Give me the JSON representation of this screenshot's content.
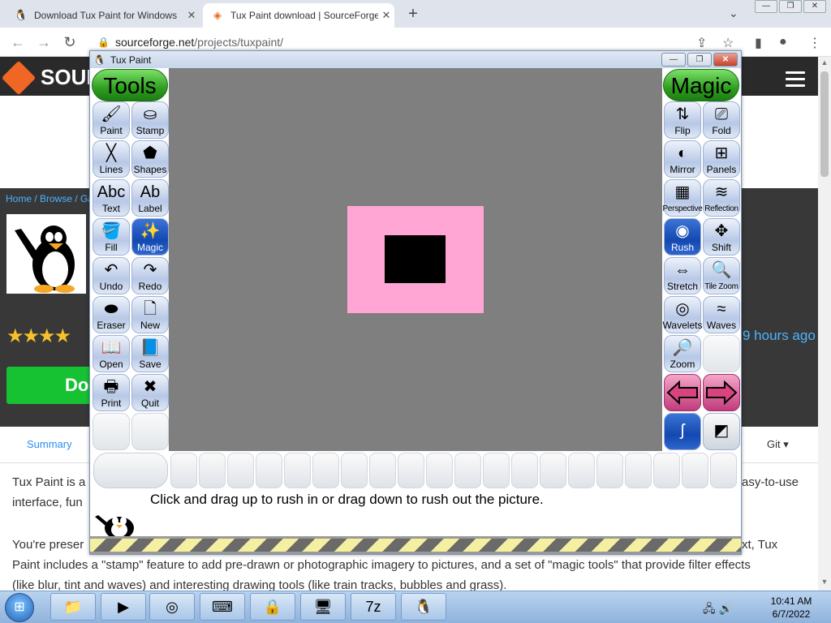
{
  "browser": {
    "tabs": [
      {
        "title": "Download Tux Paint for Windows",
        "favicon": "tux-favicon"
      },
      {
        "title": "Tux Paint download | SourceForge",
        "favicon": "sourceforge-favicon"
      }
    ],
    "new_tab_symbol": "+",
    "url_host": "sourceforge.net",
    "url_path": "/projects/tuxpaint/",
    "window_controls": [
      "—",
      "❐",
      "✕"
    ]
  },
  "page": {
    "logo_text": "SOUR",
    "breadcrumb": "Home / Browse / Ga",
    "stars": "★★★★",
    "download_label": "Do",
    "updated": "9 hours ago",
    "summary_tab": "Summary",
    "git_tab": "Git ▾",
    "line1_left": "Tux Paint is a",
    "line1_right": "asy-to-use",
    "line2": "interface, fun",
    "line3_left": "You're preser",
    "line3_right": "xt, Tux",
    "line4": "Paint includes a \"stamp\" feature to add pre-drawn or photographic imagery to pictures, and a set of \"magic tools\" that provide filter effects",
    "line5": "(like blur, tint and waves) and interesting drawing tools (like train tracks, bubbles and grass)."
  },
  "tuxpaint": {
    "window_title": "Tux Paint",
    "tools_header": "Tools",
    "magic_header": "Magic",
    "tools": [
      {
        "label": "Paint",
        "icon": "brush-icon",
        "glyph": "🖌"
      },
      {
        "label": "Stamp",
        "icon": "stamp-icon",
        "glyph": "⛀"
      },
      {
        "label": "Lines",
        "icon": "lines-icon",
        "glyph": "╳"
      },
      {
        "label": "Shapes",
        "icon": "pentagon-icon",
        "glyph": "⬟"
      },
      {
        "label": "Text",
        "icon": "text-icon",
        "glyph": "Abc"
      },
      {
        "label": "Label",
        "icon": "label-icon",
        "glyph": "Ab"
      },
      {
        "label": "Fill",
        "icon": "bucket-icon",
        "glyph": "🪣"
      },
      {
        "label": "Magic",
        "icon": "magic-wand-icon",
        "glyph": "✨"
      },
      {
        "label": "Undo",
        "icon": "undo-icon",
        "glyph": "↶"
      },
      {
        "label": "Redo",
        "icon": "redo-icon",
        "glyph": "↷"
      },
      {
        "label": "Eraser",
        "icon": "eraser-icon",
        "glyph": "⬬"
      },
      {
        "label": "New",
        "icon": "new-page-icon",
        "glyph": "🗋"
      },
      {
        "label": "Open",
        "icon": "open-book-icon",
        "glyph": "📖"
      },
      {
        "label": "Save",
        "icon": "save-book-icon",
        "glyph": "📘"
      },
      {
        "label": "Print",
        "icon": "printer-icon",
        "glyph": "🖶"
      },
      {
        "label": "Quit",
        "icon": "quit-icon",
        "glyph": "✖"
      }
    ],
    "magic_tools": [
      {
        "label": "Flip",
        "icon": "flip-icon",
        "glyph": "⇅"
      },
      {
        "label": "Fold",
        "icon": "fold-icon",
        "glyph": "⎚"
      },
      {
        "label": "Mirror",
        "icon": "mirror-icon",
        "glyph": "◐"
      },
      {
        "label": "Panels",
        "icon": "panels-icon",
        "glyph": "⊞"
      },
      {
        "label": "Perspective",
        "icon": "perspective-icon",
        "glyph": "▦"
      },
      {
        "label": "Reflection",
        "icon": "reflection-icon",
        "glyph": "≋"
      },
      {
        "label": "Rush",
        "icon": "rush-icon",
        "glyph": "◉"
      },
      {
        "label": "Shift",
        "icon": "shift-arrows-icon",
        "glyph": "✥"
      },
      {
        "label": "Stretch",
        "icon": "stretch-icon",
        "glyph": "⇔"
      },
      {
        "label": "Tile Zoom",
        "icon": "tile-zoom-icon",
        "glyph": "🔍"
      },
      {
        "label": "Wavelets",
        "icon": "wavelets-icon",
        "glyph": "◎"
      },
      {
        "label": "Waves",
        "icon": "waves-icon",
        "glyph": "≈"
      },
      {
        "label": "Zoom",
        "icon": "zoom-icon",
        "glyph": "🔎"
      }
    ],
    "status_message": "Click and drag up to rush in or drag down to rush out the picture.",
    "colors": {
      "canvas": "#7f7f7f",
      "pink": "#ffa6d4",
      "black": "#000000",
      "header_green": "#2f9e1f",
      "selected_blue": "#1348b0"
    }
  },
  "taskbar": {
    "start_glyph": "⊞",
    "apps": [
      {
        "name": "explorer-icon",
        "glyph": "📁"
      },
      {
        "name": "media-player-icon",
        "glyph": "▶"
      },
      {
        "name": "chrome-icon",
        "glyph": "◎"
      },
      {
        "name": "keyboard-icon",
        "glyph": "⌨"
      },
      {
        "name": "shield-lock-icon",
        "glyph": "🔒"
      },
      {
        "name": "computer-icon",
        "glyph": "🖥"
      },
      {
        "name": "7zip-icon",
        "glyph": "7z"
      },
      {
        "name": "tuxpaint-icon",
        "glyph": "🐧"
      }
    ],
    "time": "10:41 AM",
    "date": "6/7/2022",
    "tray_glyphs": "🖧 🔊"
  }
}
